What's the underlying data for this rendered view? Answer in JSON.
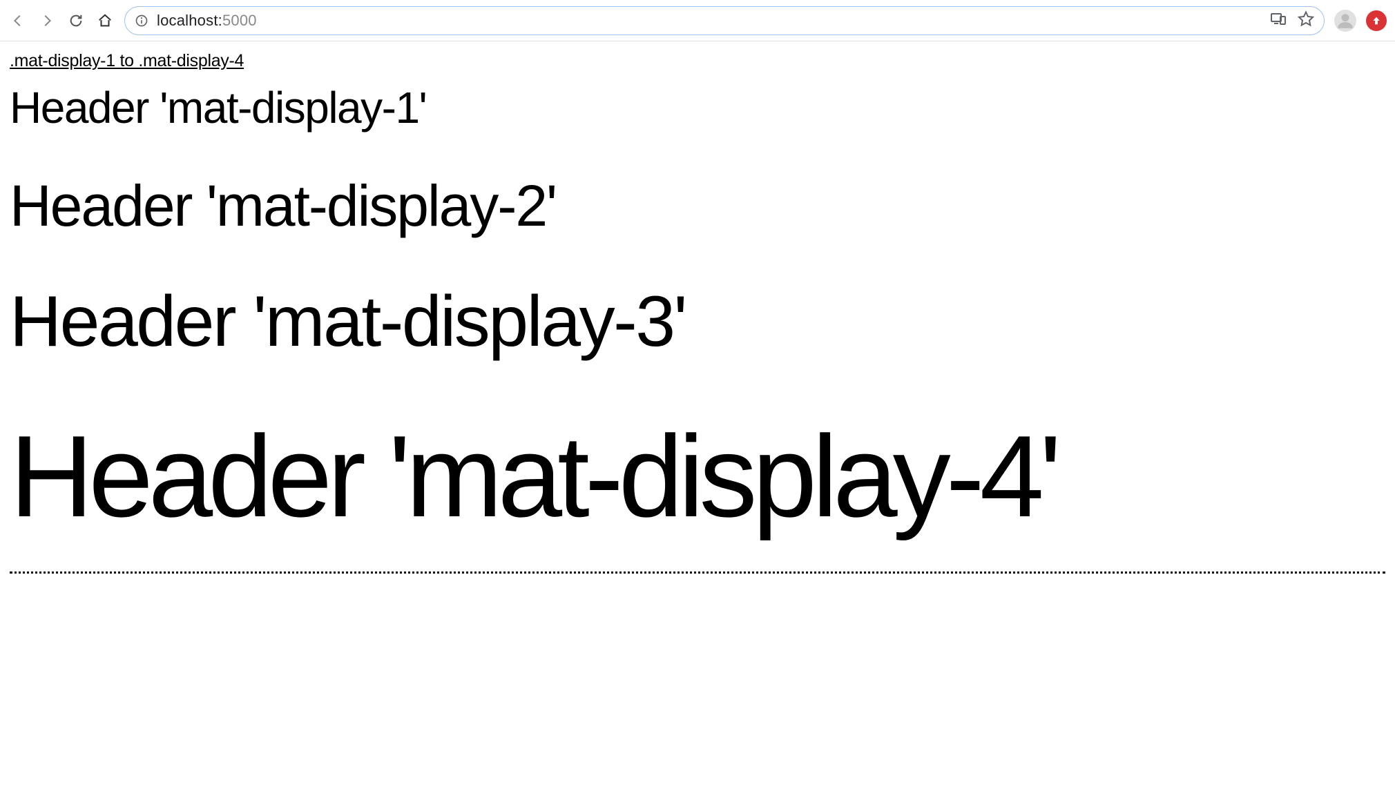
{
  "browser": {
    "url_host": "localhost:",
    "url_port": "5000"
  },
  "content": {
    "section_title": ".mat-display-1 to .mat-display-4",
    "headers": {
      "d1": "Header 'mat-display-1'",
      "d2": "Header 'mat-display-2'",
      "d3": "Header 'mat-display-3'",
      "d4": "Header 'mat-display-4'"
    }
  }
}
